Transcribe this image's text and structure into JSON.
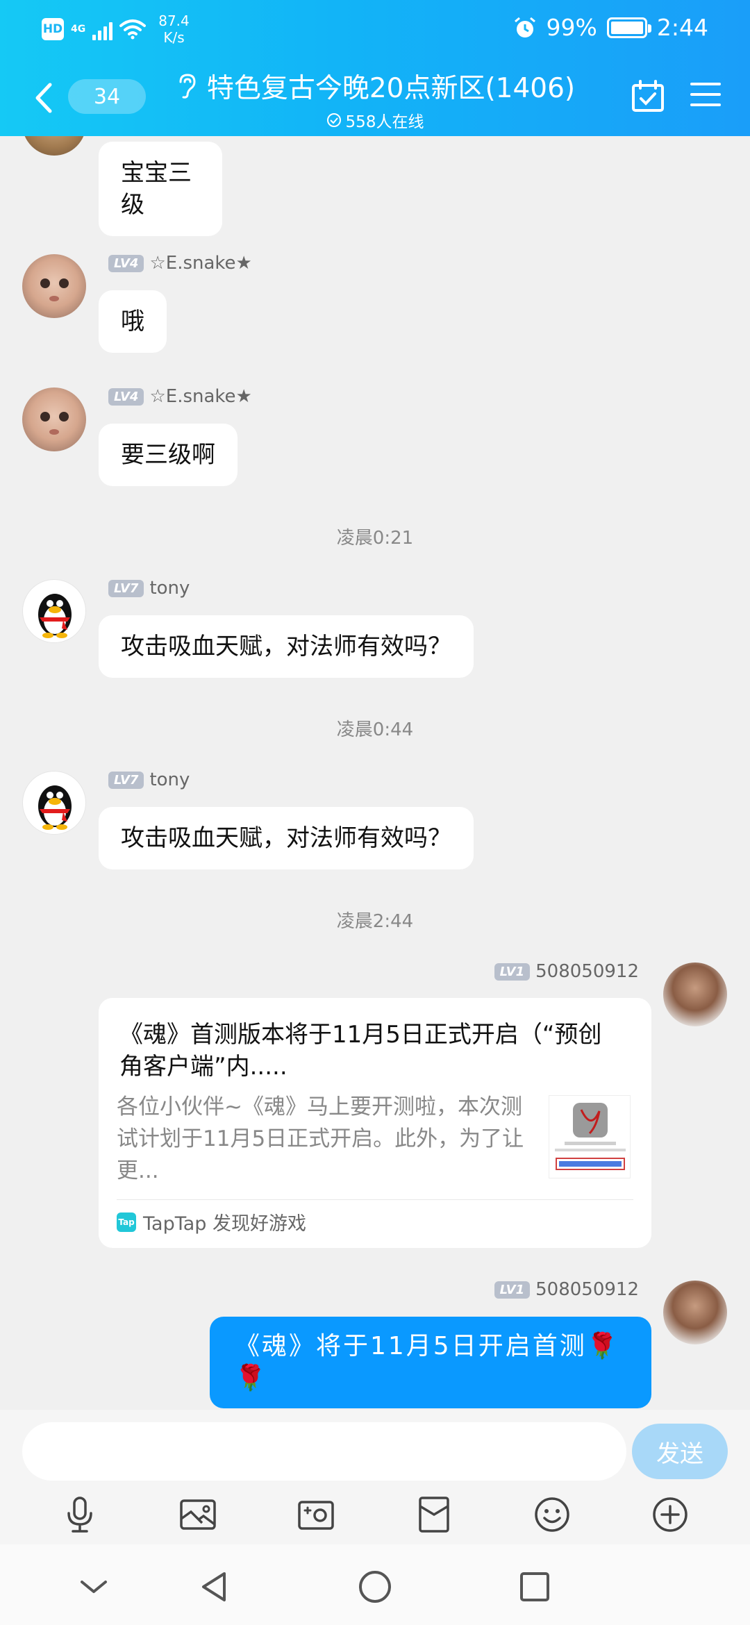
{
  "status_bar": {
    "hd": "HD",
    "network": "4G",
    "net_speed_value": "87.4",
    "net_speed_unit": "K/s",
    "battery": "99%",
    "time": "2:44"
  },
  "header": {
    "unread_count": "34",
    "title": "特色复古今晚20点新区(1406)",
    "online": "558人在线"
  },
  "messages": [
    {
      "text": "宝宝三\n级"
    },
    {
      "level": "LV4",
      "sender": "☆E.snake★",
      "text": "哦"
    },
    {
      "level": "LV4",
      "sender": "☆E.snake★",
      "text": "要三级啊"
    },
    {
      "level": "LV7",
      "sender": "tony",
      "text": "攻击吸血天赋，对法师有效吗？"
    },
    {
      "level": "LV7",
      "sender": "tony",
      "text": "攻击吸血天赋，对法师有效吗？"
    },
    {
      "level": "LV1",
      "sender": "508050912"
    },
    {
      "level": "LV1",
      "sender": "508050912",
      "text": "《魂》将于11月5日开启首测🌹🌹"
    }
  ],
  "timestamps": [
    "凌晨0:21",
    "凌晨0:44",
    "凌晨2:44"
  ],
  "share_card": {
    "title": "《魂》首测版本将于11月5日正式开启（“预创角客户端”内.....",
    "description": "各位小伙伴~《魂》马上要开测啦，本次测试计划于11月5日正式开启。此外，为了让更...",
    "source_icon": "Tap",
    "source": "TapTap 发现好游戏"
  },
  "input_bar": {
    "placeholder": "",
    "send_label": "发送"
  },
  "icons": {
    "tools": [
      "microphone-icon",
      "image-icon",
      "camera-icon",
      "red-packet-icon",
      "emoji-icon",
      "plus-icon"
    ],
    "nav": [
      "chevron-down-icon",
      "back-triangle-icon",
      "home-circle-icon",
      "recents-square-icon"
    ]
  },
  "colors": {
    "header_gradient_start": "#15c9f5",
    "header_gradient_end": "#1a9ef9",
    "my_bubble": "#0a99ff",
    "send_button": "#a8d8f8",
    "background": "#f0f0f0"
  }
}
